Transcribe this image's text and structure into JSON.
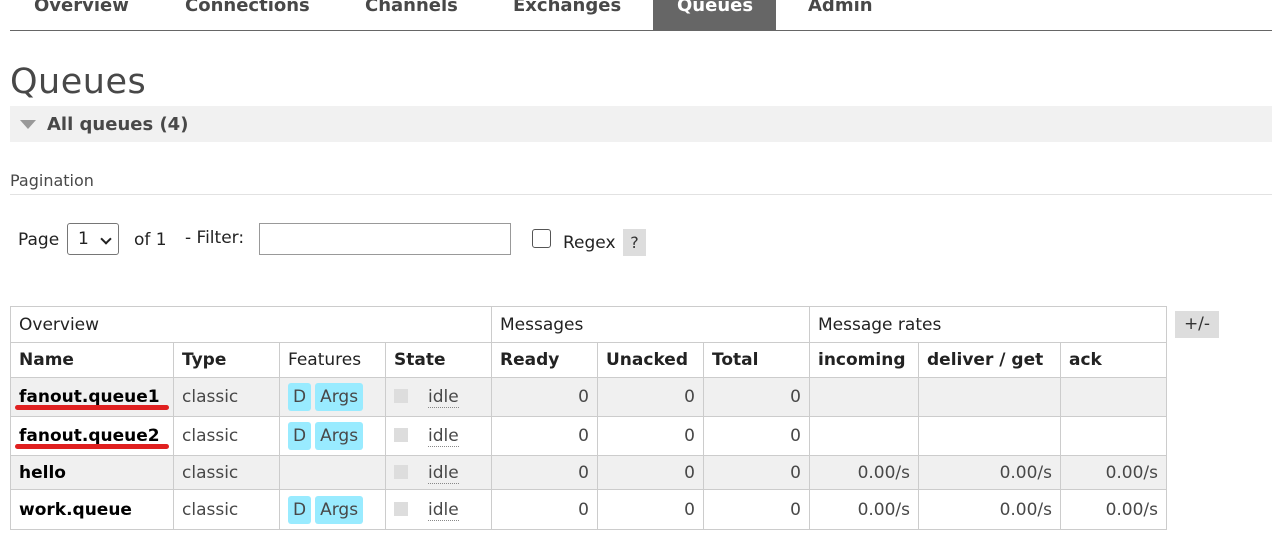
{
  "nav": {
    "tabs": [
      {
        "label": "Overview",
        "active": false
      },
      {
        "label": "Connections",
        "active": false
      },
      {
        "label": "Channels",
        "active": false
      },
      {
        "label": "Exchanges",
        "active": false
      },
      {
        "label": "Queues",
        "active": true
      },
      {
        "label": "Admin",
        "active": false
      }
    ]
  },
  "page": {
    "title": "Queues",
    "section_title": "All queues (4)"
  },
  "pagination": {
    "label": "Pagination",
    "page_label": "Page",
    "page_value": "1",
    "of_label": "of 1",
    "filter_label": "- Filter:",
    "filter_value": "",
    "regex_label": "Regex",
    "regex_checked": false,
    "help_label": "?"
  },
  "table": {
    "group_headers": {
      "overview": "Overview",
      "messages": "Messages",
      "rates": "Message rates"
    },
    "columns": {
      "name": "Name",
      "type": "Type",
      "features": "Features",
      "state": "State",
      "ready": "Ready",
      "unacked": "Unacked",
      "total": "Total",
      "incoming": "incoming",
      "deliver_get": "deliver / get",
      "ack": "ack"
    },
    "toggle_label": "+/-",
    "feature_durable": "D",
    "feature_args": "Args",
    "rows": [
      {
        "name": "fanout.queue1",
        "type": "classic",
        "state": "idle",
        "ready": "0",
        "unacked": "0",
        "total": "0",
        "incoming": "",
        "deliver_get": "",
        "ack": "",
        "highlighted": true
      },
      {
        "name": "fanout.queue2",
        "type": "classic",
        "state": "idle",
        "ready": "0",
        "unacked": "0",
        "total": "0",
        "incoming": "",
        "deliver_get": "",
        "ack": "",
        "highlighted": true
      },
      {
        "name": "hello",
        "type": "classic",
        "state": "idle",
        "ready": "0",
        "unacked": "0",
        "total": "0",
        "incoming": "0.00/s",
        "deliver_get": "0.00/s",
        "ack": "0.00/s",
        "highlighted": false
      },
      {
        "name": "work.queue",
        "type": "classic",
        "state": "idle",
        "ready": "0",
        "unacked": "0",
        "total": "0",
        "incoming": "0.00/s",
        "deliver_get": "0.00/s",
        "ack": "0.00/s",
        "highlighted": false
      }
    ]
  },
  "colors": {
    "nav_active_bg": "#666666",
    "badge_bg": "#99ebff",
    "annotation": "#e02020"
  }
}
